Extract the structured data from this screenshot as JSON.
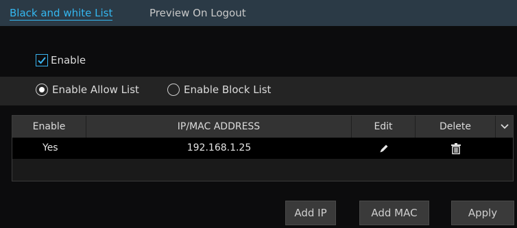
{
  "tabs": [
    {
      "label": "Black and white List",
      "active": true
    },
    {
      "label": "Preview On Logout",
      "active": false
    }
  ],
  "enable": {
    "label": "Enable",
    "checked": true
  },
  "list_mode": {
    "options": [
      {
        "label": "Enable Allow List",
        "selected": true
      },
      {
        "label": "Enable Block List",
        "selected": false
      }
    ]
  },
  "table": {
    "columns": [
      "Enable",
      "IP/MAC ADDRESS",
      "Edit",
      "Delete"
    ],
    "rows": [
      {
        "enable": "Yes",
        "address": "192.168.1.25",
        "edit_icon": "pencil-icon",
        "delete_icon": "trash-icon"
      }
    ]
  },
  "buttons": {
    "add_ip": "Add IP",
    "add_mac": "Add MAC",
    "apply": "Apply"
  },
  "colors": {
    "accent": "#34b7f0",
    "tab_bar": "#2b3a46",
    "background": "#0c0c0d"
  }
}
